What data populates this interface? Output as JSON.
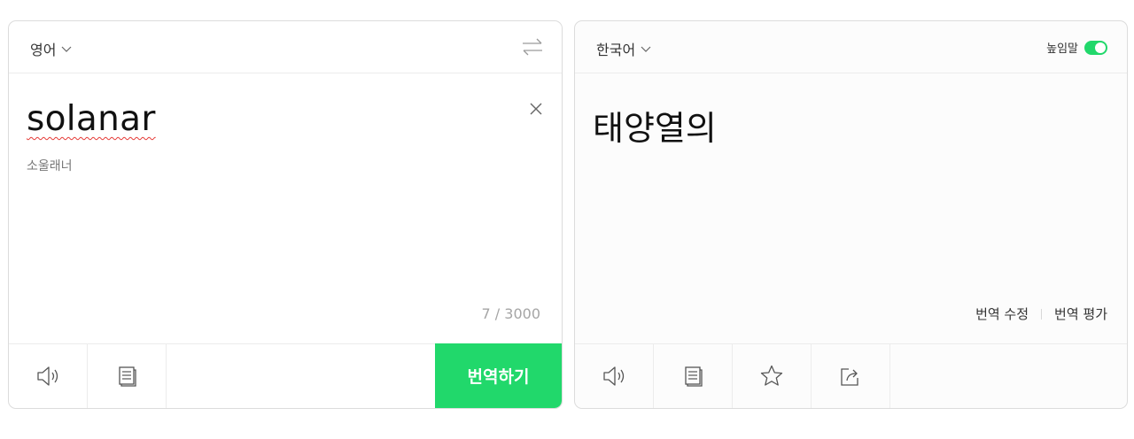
{
  "source": {
    "language": "영어",
    "text": "solanar",
    "pronunciation": "소울래너",
    "char_count": "7 / 3000",
    "translate_label": "번역하기",
    "icons": {
      "language_dropdown": "chevron-down-icon",
      "swap": "swap-arrows-icon",
      "clear": "close-icon",
      "listen": "speaker-icon",
      "copy": "copy-icon"
    }
  },
  "target": {
    "language": "한국어",
    "honorific_label": "높임말",
    "honorific_on": true,
    "text": "태양열의",
    "edit_label": "번역 수정",
    "rate_label": "번역 평가",
    "icons": {
      "language_dropdown": "chevron-down-icon",
      "listen": "speaker-icon",
      "copy": "copy-icon",
      "favorite": "star-icon",
      "share": "share-icon"
    }
  },
  "colors": {
    "accent": "#21d86b",
    "spellcheck": "#e53935"
  }
}
